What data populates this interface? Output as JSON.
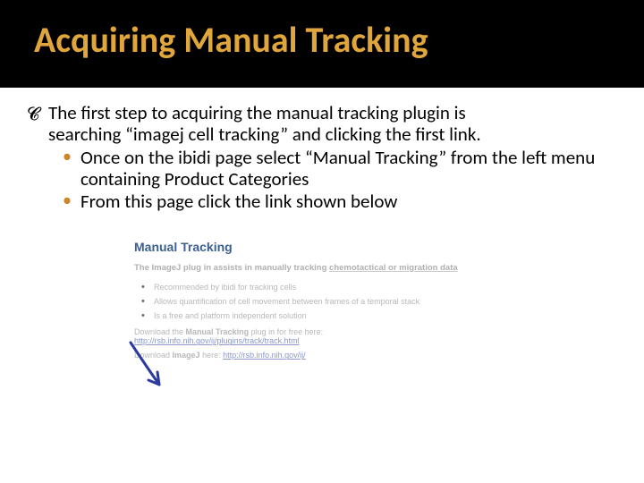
{
  "title": "Acquiring Manual Tracking",
  "body": {
    "line1": "The first step to acquiring the manual tracking plugin  is",
    "line2": "searching “imagej cell tracking” and clicking the first link.",
    "bullets": [
      "Once on the ibidi page select “Manual Tracking” from the left menu containing Product Categories",
      "From this page click the link shown below"
    ]
  },
  "embedded": {
    "heading": "Manual Tracking",
    "intro_prefix": "The ImageJ plug in assists in manually tracking ",
    "intro_link": "chemotactical or migration data",
    "features": [
      "Recommended by ibidi for tracking cells",
      "Allows quantification of cell movement between frames of a temporal stack",
      "Is a free and platform independent solution"
    ],
    "download_mt_prefix": "Download the ",
    "download_mt_bold": "Manual Tracking",
    "download_mt_suffix": " plug in for free here:",
    "download_mt_link": "http://rsb.info.nih.gov/ij/plugins/track/track.html",
    "download_ij_prefix": "Download ",
    "download_ij_bold": "ImageJ",
    "download_ij_suffix": " here: ",
    "download_ij_link": "http://rsb.info.nih.gov/ij/"
  }
}
